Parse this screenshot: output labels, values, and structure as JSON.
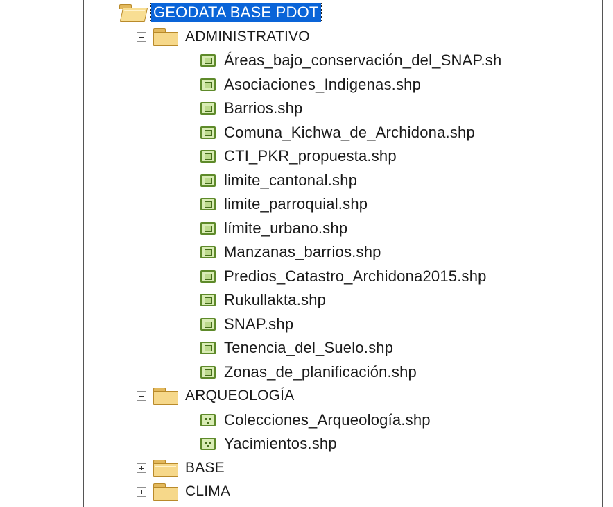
{
  "root": {
    "label": "GEODATA BASE PDOT",
    "expanded": true,
    "selected": true
  },
  "folders": [
    {
      "label": "ADMINISTRATIVO",
      "expanded": true,
      "layers": [
        {
          "label": "Áreas_bajo_conservación_del_SNAP.sh",
          "type": "polygon"
        },
        {
          "label": "Asociaciones_Indigenas.shp",
          "type": "polygon"
        },
        {
          "label": "Barrios.shp",
          "type": "polygon"
        },
        {
          "label": "Comuna_Kichwa_de_Archidona.shp",
          "type": "polygon"
        },
        {
          "label": "CTI_PKR_propuesta.shp",
          "type": "polygon"
        },
        {
          "label": "limite_cantonal.shp",
          "type": "polygon"
        },
        {
          "label": "limite_parroquial.shp",
          "type": "polygon"
        },
        {
          "label": "límite_urbano.shp",
          "type": "polygon"
        },
        {
          "label": "Manzanas_barrios.shp",
          "type": "polygon"
        },
        {
          "label": "Predios_Catastro_Archidona2015.shp",
          "type": "polygon"
        },
        {
          "label": "Rukullakta.shp",
          "type": "polygon"
        },
        {
          "label": "SNAP.shp",
          "type": "polygon"
        },
        {
          "label": "Tenencia_del_Suelo.shp",
          "type": "polygon"
        },
        {
          "label": "Zonas_de_planificación.shp",
          "type": "polygon"
        }
      ]
    },
    {
      "label": "ARQUEOLOGÍA",
      "expanded": true,
      "layers": [
        {
          "label": "Colecciones_Arqueología.shp",
          "type": "point"
        },
        {
          "label": "Yacimientos.shp",
          "type": "point"
        }
      ]
    },
    {
      "label": "BASE",
      "expanded": false,
      "layers": []
    },
    {
      "label": "CLIMA",
      "expanded": false,
      "layers": []
    }
  ],
  "colors": {
    "selection": "#0a64d8",
    "folder": "#f6d88a",
    "layer_icon_border": "#5e8a2a"
  }
}
